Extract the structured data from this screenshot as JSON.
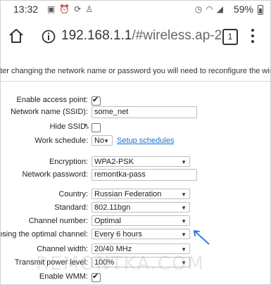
{
  "statusbar": {
    "time": "13:32",
    "battery": "59%",
    "icons_left": [
      "image-icon",
      "alarm-icon",
      "sync-icon",
      "person-icon"
    ],
    "icons_right": [
      "alarm-clock-icon",
      "wifi-icon",
      "signal-icon"
    ]
  },
  "browser": {
    "url_host": "192.168.1.1",
    "url_path": "/#wireless.ap-2",
    "tab_count": "1"
  },
  "notice": "fter changing the network name or password you will need to reconfigure the wirel",
  "form": {
    "enable_ap_label": "Enable access point:",
    "ssid_label": "Network name (SSID):",
    "ssid_value": "some_net",
    "hide_ssid_label": "Hide SSID:",
    "work_schedule_label": "Work schedule:",
    "work_schedule_value": "No",
    "setup_schedules_link": "Setup schedules",
    "encryption_label": "Encryption:",
    "encryption_value": "WPA2-PSK",
    "password_label": "Network password:",
    "password_value": "remontka-pass",
    "country_label": "Country:",
    "country_value": "Russian Federation",
    "standard_label": "Standard:",
    "standard_value": "802.11bgn",
    "channel_number_label": "Channel number:",
    "channel_number_value": "Optimal",
    "optimal_channel_label": "osing the optimal channel:",
    "optimal_channel_value": "Every 6 hours",
    "channel_width_label": "Channel width:",
    "channel_width_value": "20/40 MHz",
    "tx_power_label": "Transmit power level:",
    "tx_power_value": "100%",
    "wmm_label": "Enable WMM:"
  },
  "watermark": "REMONTKA.COM",
  "colors": {
    "link": "#1a6fd0",
    "annotation_arrow": "#1a6fd0"
  }
}
